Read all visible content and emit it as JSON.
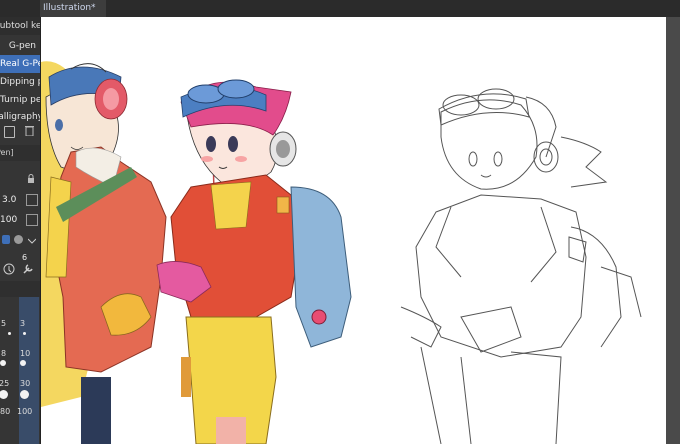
{
  "document": {
    "tab_title": "Illustration*"
  },
  "tool_panel": {
    "title": "Subtool ker",
    "subtools": [
      {
        "label": "G-pen",
        "selected": false
      },
      {
        "label": "Real G-Pen",
        "selected": true
      },
      {
        "label": "Dipping pen",
        "selected": false
      },
      {
        "label": "Turnip pen",
        "selected": false
      },
      {
        "label": "Calligraphy",
        "selected": false
      }
    ],
    "section_label": "Pen]",
    "brush_size": "3.0",
    "opacity": "100",
    "spacing": "6",
    "size_presets": [
      "5",
      "3",
      "8",
      "10",
      "25",
      "30",
      "80",
      "100"
    ]
  },
  "colors": {
    "accent": "#3e6fb8"
  }
}
